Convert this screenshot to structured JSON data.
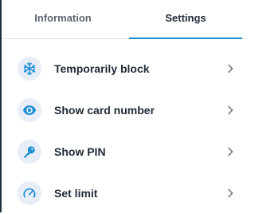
{
  "tabs": [
    {
      "label": "Information",
      "active": false
    },
    {
      "label": "Settings",
      "active": true
    }
  ],
  "actions": [
    {
      "label": "Temporarily block",
      "icon": "snowflake-icon"
    },
    {
      "label": "Show card number",
      "icon": "eye-icon"
    },
    {
      "label": "Show PIN",
      "icon": "key-icon"
    },
    {
      "label": "Set limit",
      "icon": "speedometer-icon"
    }
  ],
  "colors": {
    "accent": "#1e8fd5",
    "icon_background": "#e8eef7",
    "text_dark": "#1f2a36",
    "text_muted": "#5f6770"
  }
}
